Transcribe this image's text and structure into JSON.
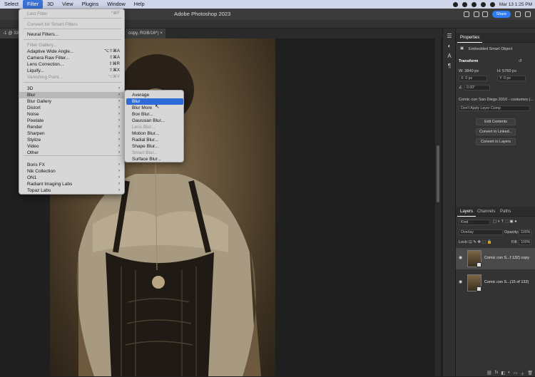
{
  "menubar": {
    "items": [
      "Select",
      "Filter",
      "3D",
      "View",
      "Plugins",
      "Window",
      "Help"
    ],
    "active": "Filter",
    "clock": "Mar 13  1:25 PM"
  },
  "app": {
    "title": "Adobe Photoshop 2023",
    "share_label": "Share"
  },
  "doc_tabs": [
    {
      "label": "-1 @ 33.3"
    },
    {
      "label": "copy, RGB/16*) ×"
    }
  ],
  "filter_menu": {
    "items": [
      {
        "label": "Last Filter",
        "shortcut": "^⌘F",
        "disabled": true
      },
      {
        "label": "Convert for Smart Filters",
        "disabled": true
      },
      {
        "label": "Neural Filters...",
        "disabled": false
      },
      {
        "label": "Filter Gallery...",
        "disabled": true
      },
      {
        "label": "Adaptive Wide Angle...",
        "shortcut": "⌥⇧⌘A",
        "disabled": false
      },
      {
        "label": "Camera Raw Filter...",
        "shortcut": "⇧⌘A",
        "disabled": false
      },
      {
        "label": "Lens Correction...",
        "shortcut": "⇧⌘R",
        "disabled": false
      },
      {
        "label": "Liquify...",
        "shortcut": "⇧⌘X",
        "disabled": false
      },
      {
        "label": "Vanishing Point...",
        "shortcut": "⌥⌘V",
        "disabled": true
      },
      {
        "label": "3D",
        "submenu": true
      },
      {
        "label": "Blur",
        "submenu": true,
        "highlighted": true
      },
      {
        "label": "Blur Gallery",
        "submenu": true
      },
      {
        "label": "Distort",
        "submenu": true
      },
      {
        "label": "Noise",
        "submenu": true
      },
      {
        "label": "Pixelate",
        "submenu": true
      },
      {
        "label": "Render",
        "submenu": true
      },
      {
        "label": "Sharpen",
        "submenu": true
      },
      {
        "label": "Stylize",
        "submenu": true
      },
      {
        "label": "Video",
        "submenu": true
      },
      {
        "label": "Other",
        "submenu": true
      },
      {
        "label": "Boris FX",
        "submenu": true
      },
      {
        "label": "Nik Collection",
        "submenu": true
      },
      {
        "label": "ON1",
        "submenu": true
      },
      {
        "label": "Radiant Imaging Labs",
        "submenu": true
      },
      {
        "label": "Topaz Labs",
        "submenu": true
      }
    ]
  },
  "blur_submenu": {
    "items": [
      {
        "label": "Average"
      },
      {
        "label": "Blur",
        "selected": true
      },
      {
        "label": "Blur More"
      },
      {
        "label": "Box Blur..."
      },
      {
        "label": "Gaussian Blur..."
      },
      {
        "label": "Lens Blur...",
        "disabled": true
      },
      {
        "label": "Motion Blur..."
      },
      {
        "label": "Radial Blur..."
      },
      {
        "label": "Shape Blur..."
      },
      {
        "label": "Smart Blur...",
        "disabled": true
      },
      {
        "label": "Surface Blur..."
      }
    ]
  },
  "properties": {
    "tab": "Properties",
    "object_type": "Embedded Smart Object",
    "section": "Transform",
    "w": "W:  3840 px",
    "h": "H:  5760 px",
    "x": "X:  0 px",
    "y": "Y:  0 px",
    "angle": "0.00°",
    "source": "Comic con San Diego 2010 - costumes (...",
    "layer_comp": "Don't Apply Layer Comp",
    "edit_contents": "Edit Contents",
    "convert_linked": "Convert to Linked...",
    "convert_layers": "Convert to Layers"
  },
  "layers": {
    "tabs": [
      "Layers",
      "Channels",
      "Paths"
    ],
    "kind": "Kind",
    "blend_mode": "Overlay",
    "opacity_label": "Opacity:",
    "opacity": "100%",
    "lock_label": "Lock:",
    "fill_label": "Fill:",
    "fill": "100%",
    "rows": [
      {
        "name": "Comic con S...f 132) copy",
        "selected": true
      },
      {
        "name": "Comic con S...(15 of 132)",
        "selected": false
      }
    ]
  },
  "colors": {
    "menu_selection": "#2e6bd6",
    "share": "#2f7df6"
  }
}
